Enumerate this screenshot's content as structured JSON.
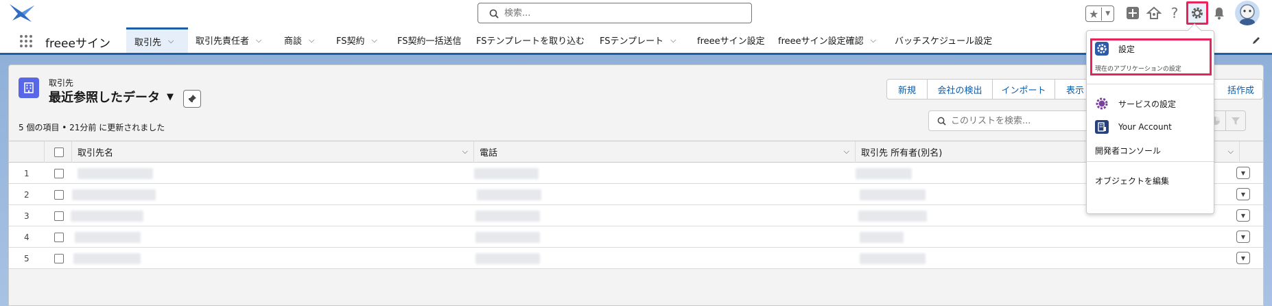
{
  "header": {
    "search_placeholder": "検索...",
    "icons": [
      "app-logo-icon",
      "search-icon",
      "favorites-star-icon",
      "favorites-dropdown-icon",
      "global-actions-plus-icon",
      "trailhead-icon",
      "help-icon",
      "setup-gear-icon",
      "notifications-bell-icon",
      "avatar"
    ],
    "highlight_color": "#e8235c"
  },
  "nav": {
    "app_name": "freeeサイン",
    "tabs": [
      {
        "label": "取引先",
        "active": true,
        "chevron": true
      },
      {
        "label": "取引先責任者",
        "chevron": true
      },
      {
        "label": "商談",
        "chevron": true
      },
      {
        "label": "FS契約",
        "chevron": true
      },
      {
        "label": "FS契約一括送信",
        "chevron": false
      },
      {
        "label": "FSテンプレートを取り込む",
        "chevron": false
      },
      {
        "label": "FSテンプレート",
        "chevron": true
      },
      {
        "label": "freeeサイン設定",
        "chevron": false
      },
      {
        "label": "freeeサイン設定確認",
        "chevron": true
      },
      {
        "label": "バッチスケジュール設定",
        "chevron": false
      }
    ]
  },
  "list": {
    "object_label": "取引先",
    "view_name": "最近参照したデータ",
    "meta": "5 個の項目 • 21分前 に更新されました",
    "buttons": [
      "新規",
      "会社の検出",
      "インポート",
      "表示"
    ],
    "last_button": "括作成",
    "search_placeholder": "このリストを検索...",
    "columns": [
      "取引先名",
      "電話",
      "取引先 所有者(別名)"
    ],
    "rows": [
      "1",
      "2",
      "3",
      "4",
      "5"
    ]
  },
  "dropdown": {
    "setup_title": "設定",
    "setup_subtitle": "現在のアプリケーションの設定",
    "service_setup": "サービスの設定",
    "your_account": "Your Account",
    "developer_console": "開発者コンソール",
    "edit_object": "オブジェクトを編集"
  }
}
